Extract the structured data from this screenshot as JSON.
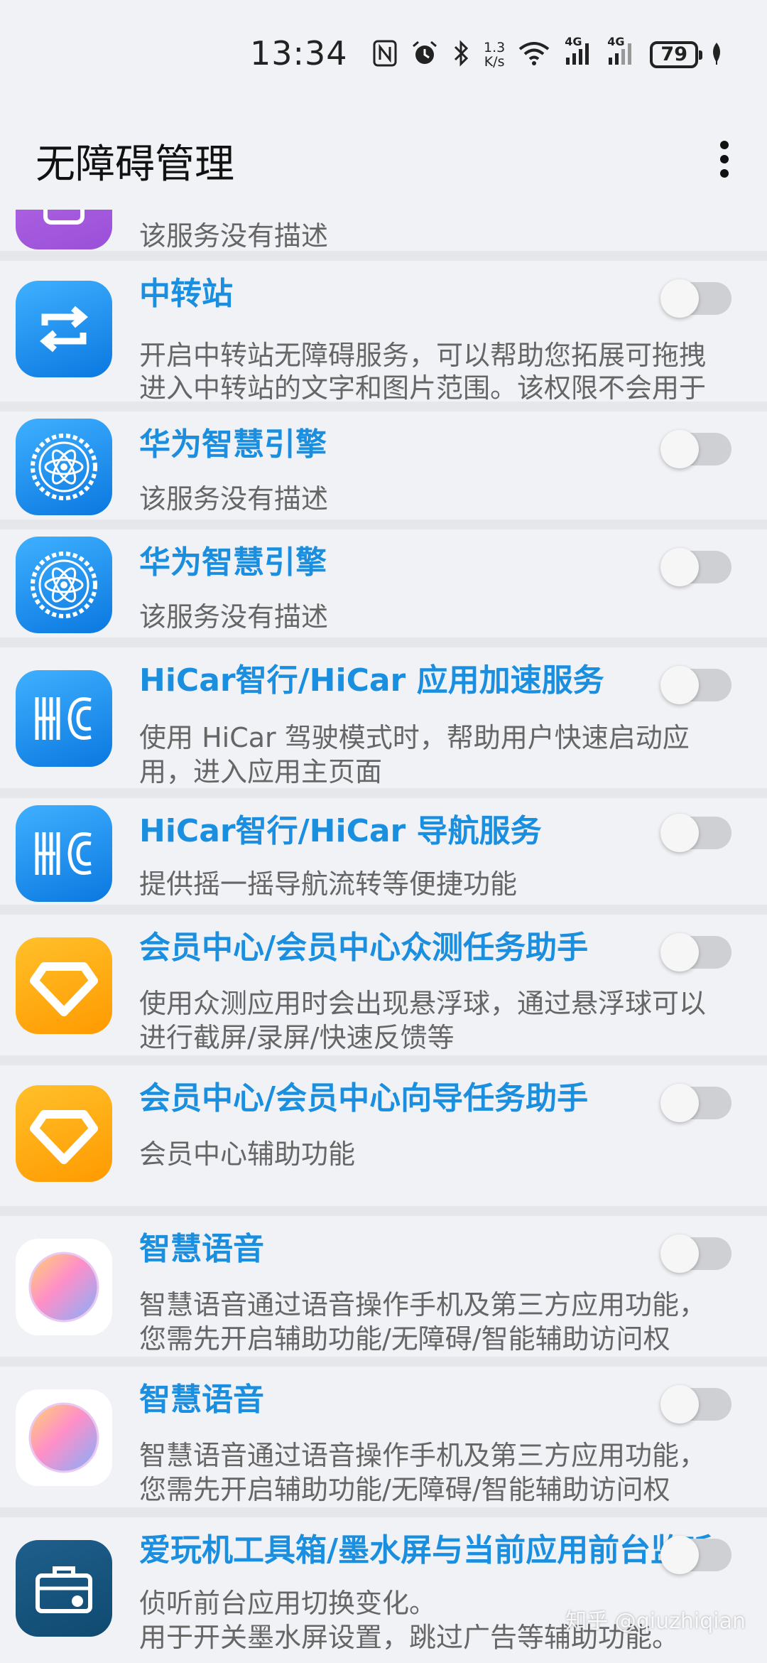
{
  "status_bar": {
    "time": "13:34",
    "network_speed_value": "1.3",
    "network_speed_unit": "K/s",
    "signal_1_label": "4G",
    "signal_2_label": "4G",
    "battery_level": "79",
    "icons": [
      "nfc-icon",
      "alarm-icon",
      "bluetooth-icon",
      "wifi-icon",
      "signal-icon",
      "signal-icon",
      "battery-icon",
      "leaf-icon"
    ]
  },
  "app_bar": {
    "title": "无障碍管理",
    "menu_icon": "more-vertical-icon"
  },
  "services": [
    {
      "title": "",
      "desc_lines": [
        "该服务没有描述"
      ],
      "icon": "purple-app-icon",
      "enabled": false
    },
    {
      "title": "中转站",
      "desc_lines": [
        "开启中转站无障碍服务，可以帮助您拓展可拖拽",
        "进入中转站的文字和图片范围。该权限不会用于"
      ],
      "icon": "transfer-arrows-icon",
      "enabled": false
    },
    {
      "title": "华为智慧引擎",
      "desc_lines": [
        "该服务没有描述"
      ],
      "icon": "atom-gear-icon",
      "enabled": false
    },
    {
      "title": "华为智慧引擎",
      "desc_lines": [
        "该服务没有描述"
      ],
      "icon": "atom-gear-icon",
      "enabled": false
    },
    {
      "title": "HiCar智行/HiCar 应用加速服务",
      "desc_lines": [
        "使用 HiCar 驾驶模式时，帮助用户快速启动应",
        "用，进入应用主页面"
      ],
      "icon": "hicar-icon",
      "enabled": false
    },
    {
      "title": "HiCar智行/HiCar 导航服务",
      "desc_lines": [
        "提供摇一摇导航流转等便捷功能"
      ],
      "icon": "hicar-icon",
      "enabled": false
    },
    {
      "title": "会员中心/会员中心众测任务助手",
      "desc_lines": [
        "使用众测应用时会出现悬浮球，通过悬浮球可以",
        "进行截屏/录屏/快速反馈等"
      ],
      "icon": "diamond-icon",
      "enabled": false
    },
    {
      "title": "会员中心/会员中心向导任务助手",
      "desc_lines": [
        "会员中心辅助功能"
      ],
      "icon": "diamond-icon",
      "enabled": false
    },
    {
      "title": "智慧语音",
      "desc_lines": [
        "智慧语音通过语音操作手机及第三方应用功能，",
        "您需先开启辅助功能/无障碍/智能辅助访问权"
      ],
      "icon": "voice-assistant-icon",
      "enabled": false
    },
    {
      "title": "智慧语音",
      "desc_lines": [
        "智慧语音通过语音操作手机及第三方应用功能，",
        "您需先开启辅助功能/无障碍/智能辅助访问权"
      ],
      "icon": "voice-assistant-icon",
      "enabled": false
    },
    {
      "title": "爱玩机工具箱/墨水屏与当前应用前台监听",
      "desc_lines": [
        "侦听前台应用切换变化。",
        "用于开关墨水屏设置，跳过广告等辅助功能。"
      ],
      "icon": "toolbox-icon",
      "enabled": false
    }
  ],
  "watermark": "知乎 @qiuzhiqian"
}
